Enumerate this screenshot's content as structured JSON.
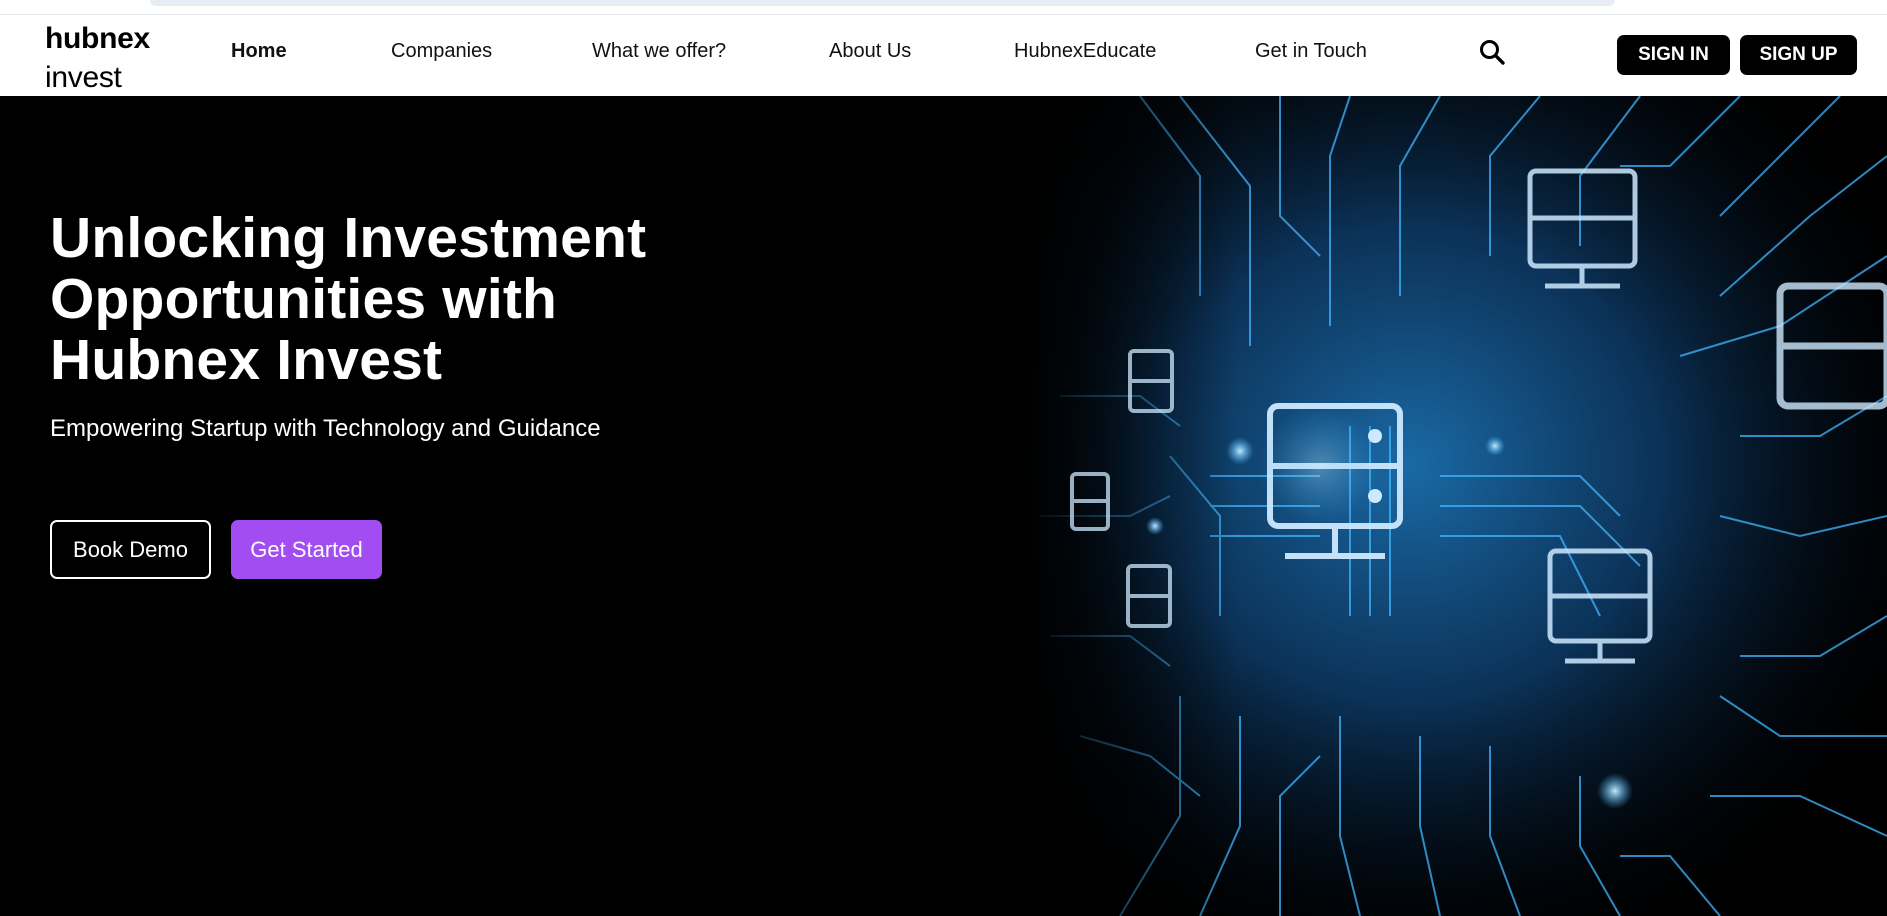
{
  "brand": {
    "name_line1": "hubnex",
    "name_line2": "invest"
  },
  "nav": {
    "items": [
      {
        "label": "Home",
        "active": true
      },
      {
        "label": "Companies",
        "active": false
      },
      {
        "label": "What we offer?",
        "active": false
      },
      {
        "label": "About Us",
        "active": false
      },
      {
        "label": "HubnexEducate",
        "active": false
      },
      {
        "label": "Get in Touch",
        "active": false
      }
    ],
    "search_icon": "search-icon",
    "sign_in_label": "SIGN IN",
    "sign_up_label": "SIGN UP"
  },
  "hero": {
    "title_line1": "Unlocking Investment",
    "title_line2": "Opportunities with",
    "title_line3": "Hubnex Invest",
    "subtitle": "Empowering Startup with Technology and Guidance",
    "book_demo_label": "Book Demo",
    "get_started_label": "Get Started",
    "image": "circuit-board-servers-illustration"
  },
  "colors": {
    "hero_background": "#000000",
    "accent_purple": "#a24df2",
    "auth_button_bg": "#000000",
    "circuit_glow": "#3fb6ff"
  }
}
